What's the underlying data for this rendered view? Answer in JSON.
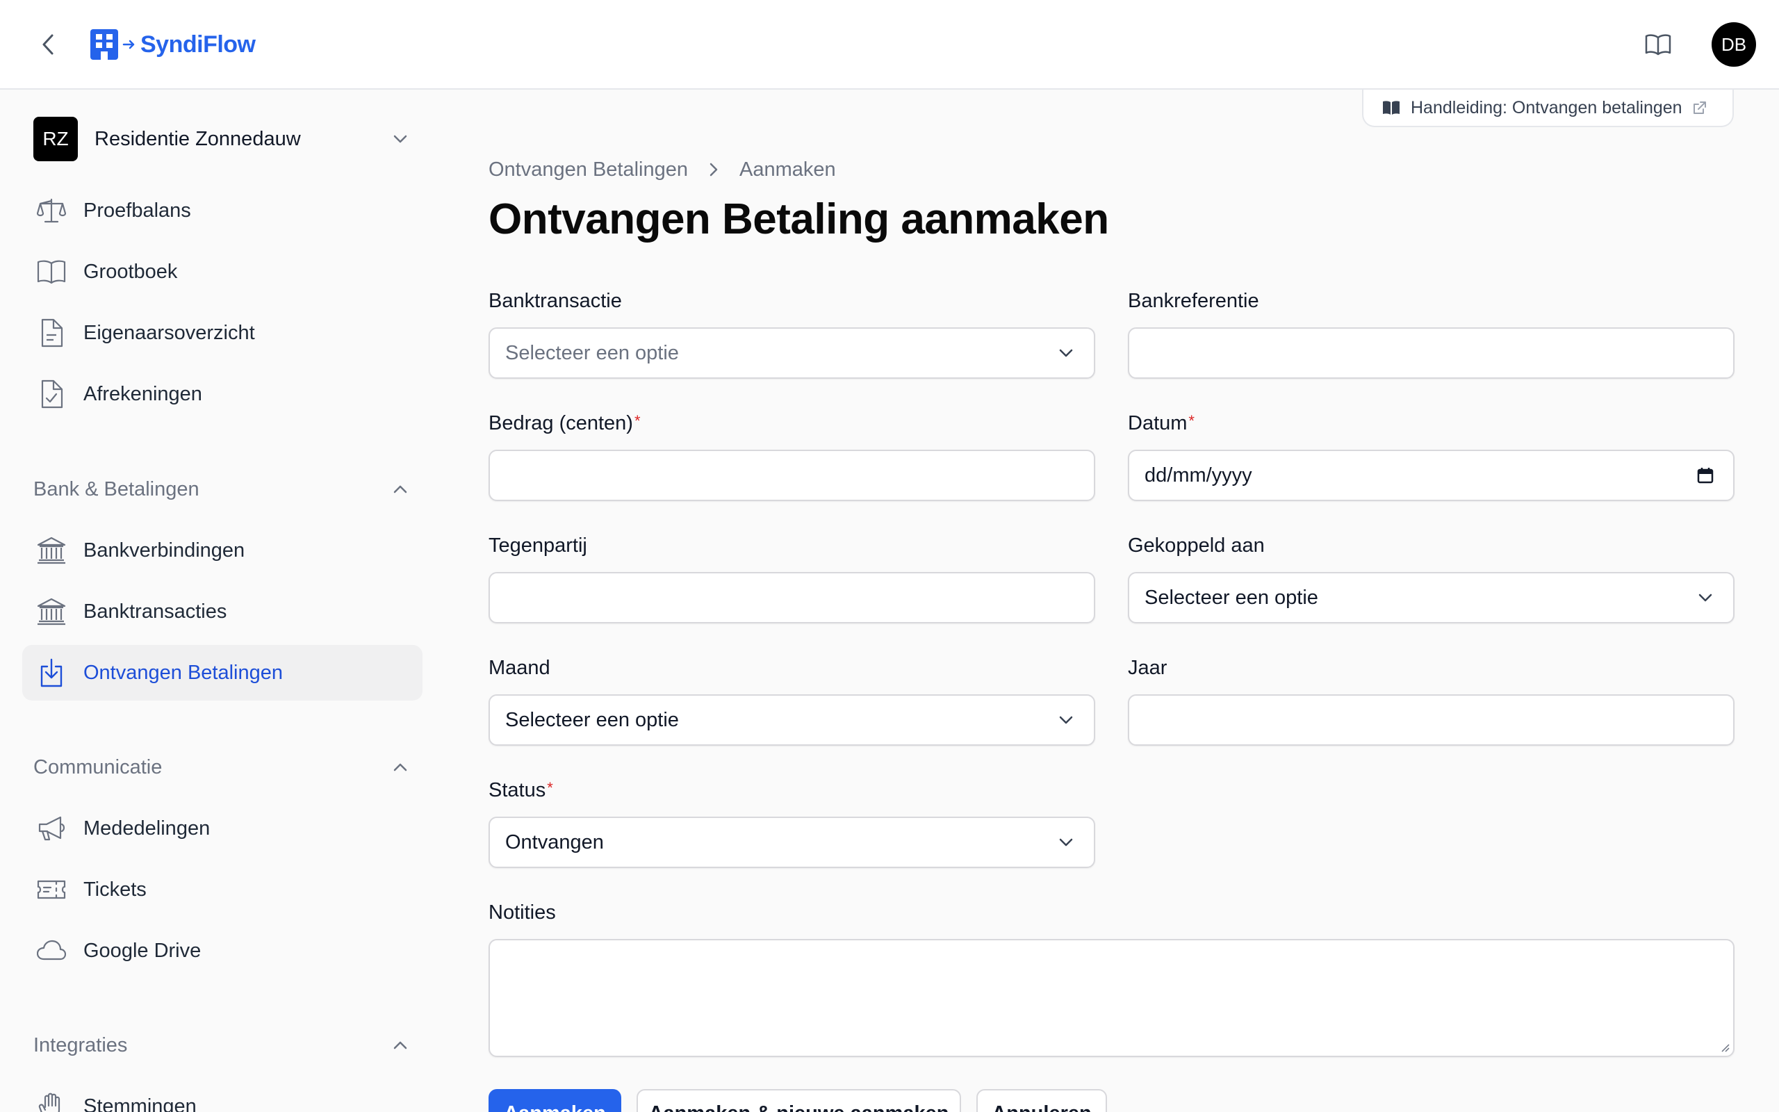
{
  "app": {
    "name": "SyndiFlow",
    "user_initials": "DB"
  },
  "sidebar": {
    "tenant": {
      "initials": "RZ",
      "name": "Residentie Zonnedauw"
    },
    "top_items": [
      {
        "label": "Proefbalans",
        "icon": "scale-icon"
      },
      {
        "label": "Grootboek",
        "icon": "book-icon"
      },
      {
        "label": "Eigenaarsoverzicht",
        "icon": "document-icon"
      },
      {
        "label": "Afrekeningen",
        "icon": "document-check-icon"
      }
    ],
    "groups": [
      {
        "label": "Bank & Betalingen",
        "items": [
          {
            "label": "Bankverbindingen",
            "icon": "bank-icon"
          },
          {
            "label": "Banktransacties",
            "icon": "bank-icon"
          },
          {
            "label": "Ontvangen Betalingen",
            "icon": "download-tray-icon",
            "active": true
          }
        ]
      },
      {
        "label": "Communicatie",
        "items": [
          {
            "label": "Mededelingen",
            "icon": "megaphone-icon"
          },
          {
            "label": "Tickets",
            "icon": "ticket-icon"
          },
          {
            "label": "Google Drive",
            "icon": "cloud-icon"
          }
        ]
      },
      {
        "label": "Integraties",
        "items": [
          {
            "label": "Stemmingen",
            "icon": "hand-icon"
          }
        ]
      }
    ]
  },
  "header": {
    "guide_label": "Handleiding: Ontvangen betalingen"
  },
  "breadcrumb": [
    "Ontvangen Betalingen",
    "Aanmaken"
  ],
  "page_title": "Ontvangen Betaling aanmaken",
  "form": {
    "banktransactie": {
      "label": "Banktransactie",
      "placeholder": "Selecteer een optie"
    },
    "bankreferentie": {
      "label": "Bankreferentie",
      "value": ""
    },
    "bedrag": {
      "label": "Bedrag (centen)",
      "required": "*",
      "value": ""
    },
    "datum": {
      "label": "Datum",
      "required": "*",
      "value": "dd/mm/yyyy"
    },
    "tegenpartij": {
      "label": "Tegenpartij",
      "value": ""
    },
    "gekoppeld": {
      "label": "Gekoppeld aan",
      "value": "Selecteer een optie"
    },
    "maand": {
      "label": "Maand",
      "value": "Selecteer een optie"
    },
    "jaar": {
      "label": "Jaar",
      "value": ""
    },
    "status": {
      "label": "Status",
      "required": "*",
      "value": "Ontvangen"
    },
    "notities": {
      "label": "Notities",
      "value": ""
    }
  },
  "actions": {
    "create": "Aanmaken",
    "create_another": "Aanmaken & nieuwe aanmaken",
    "cancel": "Annuleren"
  }
}
